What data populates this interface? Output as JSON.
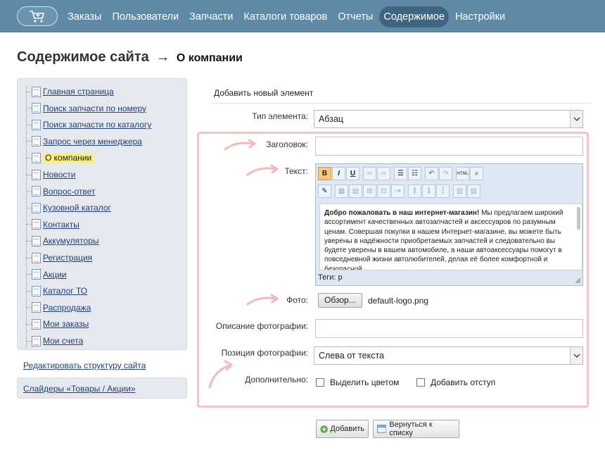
{
  "nav": {
    "items": [
      "Заказы",
      "Пользователи",
      "Запчасти",
      "Каталоги товаров",
      "Отчеты",
      "Содержимое",
      "Настройки"
    ],
    "active": "Содержимое"
  },
  "page": {
    "title": "Содержимое сайта",
    "arrow": "→",
    "subtitle": "О компании"
  },
  "sidebar": {
    "items": [
      "Главная страница",
      "Поиск запчасти по номеру",
      "Поиск запчасти по каталогу",
      "Запрос через менеджера",
      "О компании",
      "Новости",
      "Вопрос-ответ",
      "Кузовной каталог",
      "Контакты",
      "Аккумуляторы",
      "Регистрация",
      "Акции",
      "Каталог ТО",
      "Распродажа",
      "Мои заказы",
      "Мои счета"
    ],
    "selected": "О компании",
    "edit_structure": "Редактировать структуру сайта",
    "sliders": "Слайдеры «Товары / Акции»"
  },
  "form": {
    "add_title": "Добавить новый элемент",
    "type_label": "Тип элемента:",
    "type_value": "Абзац",
    "heading_label": "Заголовок:",
    "heading_value": "",
    "text_label": "Текст:",
    "editor": {
      "bold_intro": "Добро пожаловать в наш интернет-магазин!",
      "body": " Мы предлагаем широкий ассортимент качественных автозапчастей и аксессуаров по разумным ценам. Совершая покупки в нашем Интернет-магазине, вы можете быть уверены в надёжности приобретаемых запчастей и следовательно вы будете уверены в вашем автомобиле, а наши автоаксессуары помогут в повседневной жизни автолюбителей, делая её более комфортной и безопасной.",
      "tags": "Теги: p",
      "buttons_row1": [
        "B",
        "I",
        "U",
        "link",
        "unlink",
        "ul",
        "ol",
        "undo",
        "redo",
        "HTML",
        "find"
      ],
      "buttons_row2": [
        "edit",
        "table",
        "cell",
        "row-before",
        "row-after",
        "delete-row",
        "col-before",
        "col-after",
        "delete-col",
        "merge",
        "split"
      ]
    },
    "photo_label": "Фото:",
    "photo_button": "Обзор...",
    "photo_file": "default-logo.png",
    "photo_desc_label": "Описание фотографии:",
    "photo_desc_value": "",
    "photo_pos_label": "Позиция фотографии:",
    "photo_pos_value": "Слева от текста",
    "extra_label": "Дополнительно:",
    "extra_options": [
      "Выделить цветом",
      "Добавить отступ"
    ],
    "add_button": "Добавить",
    "back_button": "Вернуться к списку"
  }
}
